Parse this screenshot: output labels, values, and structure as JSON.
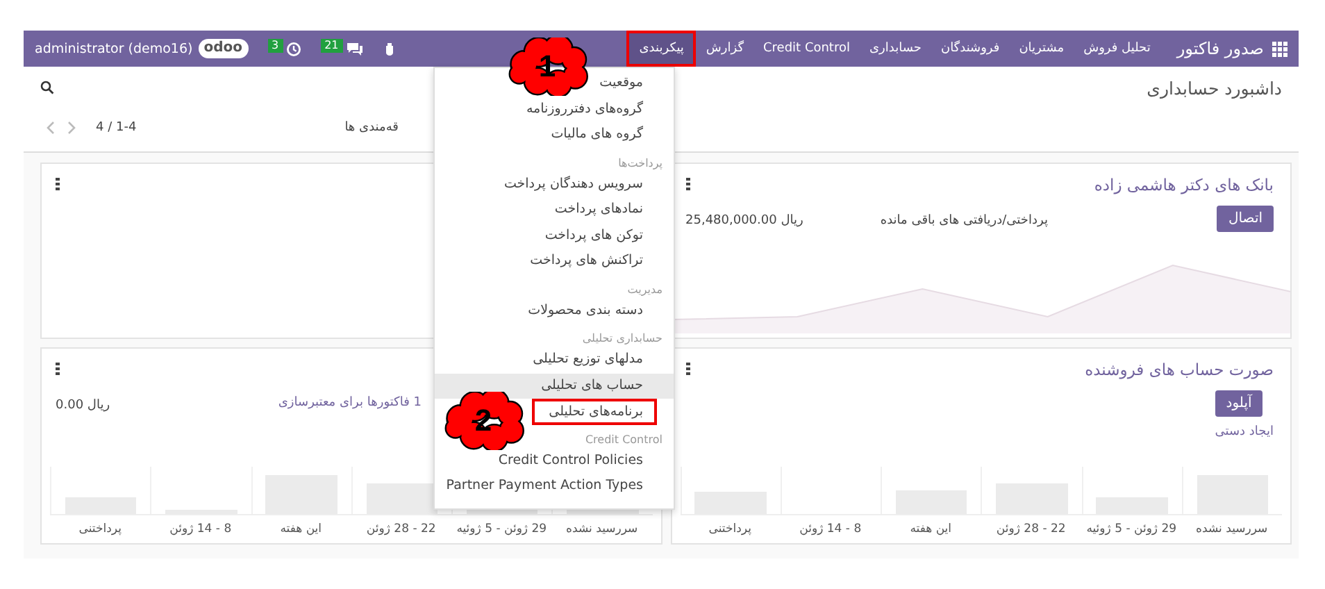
{
  "navbar": {
    "brand": "صدور فاکتور",
    "menu": [
      {
        "label": "تحلیل فروش",
        "selected": false,
        "boxed": false
      },
      {
        "label": "مشتریان",
        "selected": false,
        "boxed": false
      },
      {
        "label": "فروشندگان",
        "selected": false,
        "boxed": false
      },
      {
        "label": "حسابداری",
        "selected": false,
        "boxed": false
      },
      {
        "label": "Credit Control",
        "selected": false,
        "boxed": false
      },
      {
        "label": "گزارش",
        "selected": false,
        "boxed": false
      },
      {
        "label": "پیکربندی",
        "selected": true,
        "boxed": true
      }
    ],
    "user": "administrator (demo16)",
    "logo": "odoo",
    "activities": "3",
    "messages": "21"
  },
  "control_panel": {
    "breadcrumb": "داشبورد حسابداری",
    "favorites": "قه‌مندی ها",
    "pager": "4 / 1-4"
  },
  "cards": [
    {
      "title": "بانک های دکتر هاشمی زاده",
      "button": "اتصال",
      "label": "پرداختی/دریافتی های باقی مانده",
      "amount": "25,480,000.00 ریال",
      "menu_icon": true
    },
    {
      "menu_icon": true
    },
    {
      "title": "صورت حساب های فروشنده",
      "button": "آپلود",
      "link": "ایجاد دستی",
      "menu_icon": true,
      "bar_labels": [
        "سررسید نشده",
        "29 ژوئن - 5 ژوئیه",
        "22 - 28 ژوئن",
        "این هفته",
        "8 - 14 ژوئن",
        "پرداختنی"
      ]
    },
    {
      "link": "1 فاکتورها برای معتبرسازی",
      "amount": "0.00 ریال",
      "menu_icon": true,
      "bar_labels": [
        "سررسید نشده",
        "29 ژوئن - 5 ژوئیه",
        "22 - 28 ژوئن",
        "این هفته",
        "8 - 14 ژوئن",
        "پرداختنی"
      ]
    }
  ],
  "dropdown": [
    {
      "kind": "item",
      "label": "موقعیت",
      "selected": false,
      "boxed": false
    },
    {
      "kind": "item",
      "label": "گروه‌های دفترروزنامه",
      "selected": false,
      "boxed": false
    },
    {
      "kind": "item",
      "label": "گروه های مالیات",
      "selected": false,
      "boxed": false
    },
    {
      "kind": "header",
      "label": "پرداخت‌ها"
    },
    {
      "kind": "item",
      "label": "سرویس دهندگان پرداخت",
      "selected": false,
      "boxed": false
    },
    {
      "kind": "item",
      "label": "نمادهای پرداخت",
      "selected": false,
      "boxed": false
    },
    {
      "kind": "item",
      "label": "توکن های پرداخت",
      "selected": false,
      "boxed": false
    },
    {
      "kind": "item",
      "label": "تراکنش های پرداخت",
      "selected": false,
      "boxed": false
    },
    {
      "kind": "header",
      "label": "مدیریت"
    },
    {
      "kind": "item",
      "label": "دسته بندی محصولات",
      "selected": false,
      "boxed": false
    },
    {
      "kind": "header",
      "label": "حسابداری تحلیلی"
    },
    {
      "kind": "item",
      "label": "مدلهای توزیع تحلیلی",
      "selected": false,
      "boxed": false
    },
    {
      "kind": "item",
      "label": "حساب های تحلیلی",
      "selected": true,
      "boxed": false
    },
    {
      "kind": "item",
      "label": "برنامه‌های تحلیلی",
      "selected": false,
      "boxed": true
    },
    {
      "kind": "header",
      "label": "Credit Control"
    },
    {
      "kind": "item",
      "label": "Credit Control Policies",
      "selected": false,
      "boxed": false
    },
    {
      "kind": "item",
      "label": "Partner Payment Action Types",
      "selected": false,
      "boxed": false
    }
  ],
  "callouts": [
    {
      "label": "1"
    },
    {
      "label": "2"
    }
  ]
}
